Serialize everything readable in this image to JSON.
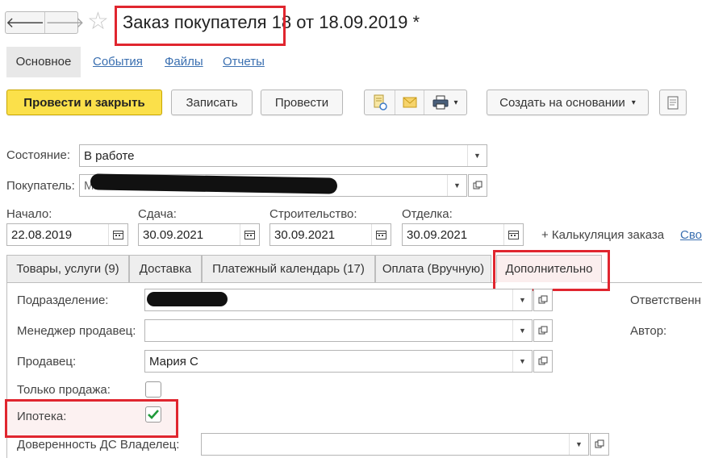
{
  "window": {
    "title": "Заказ покупателя 18 от 18.09.2019 *",
    "nav_back": "🡐",
    "nav_forward": "🡒",
    "star": "☆"
  },
  "top_tabs": [
    {
      "label": "Основное"
    },
    {
      "label": "События"
    },
    {
      "label": "Файлы"
    },
    {
      "label": "Отчеты"
    }
  ],
  "toolbar": {
    "post_close_label": "Провести и закрыть",
    "save_label": "Записать",
    "post_label": "Провести",
    "create_based_label": "Создать на основании",
    "dropdown_glyph": "▾"
  },
  "header_fields": {
    "state_label": "Состояние:",
    "state_value": "В работе",
    "customer_label": "Покупатель:",
    "customer_value": "МУНИ",
    "start_label": "Начало:",
    "start_value": "22.08.2019",
    "delivery_label": "Сдача:",
    "delivery_value": "30.09.2021",
    "construction_label": "Строительство:",
    "construction_value": "30.09.2021",
    "finishing_label": "Отделка:",
    "finishing_value": "30.09.2021",
    "calc_link": "+ Калькуляция заказа",
    "cut_link": "Сво"
  },
  "inner_tabs": [
    {
      "label": "Товары, услуги (9)"
    },
    {
      "label": "Доставка"
    },
    {
      "label": "Платежный календарь (17)"
    },
    {
      "label": "Оплата (Вручную)"
    },
    {
      "label": "Дополнительно"
    }
  ],
  "additional": {
    "division_label": "Подразделение:",
    "manager_label": "Менеджер продавец:",
    "manager_value": "",
    "seller_label": "Продавец:",
    "seller_value": "Мария С",
    "sale_only_label": "Только продажа:",
    "sale_only_checked": false,
    "mortgage_label": "Ипотека:",
    "mortgage_checked": true,
    "poa_label": "Доверенность ДС Владелец:",
    "responsible_label": "Ответственн",
    "author_label": "Автор:"
  },
  "colors": {
    "highlight_red": "#e0262f",
    "primary_yellow": "#fbe04a",
    "link_blue": "#3a6fb0",
    "check_green": "#1f9a3a"
  }
}
